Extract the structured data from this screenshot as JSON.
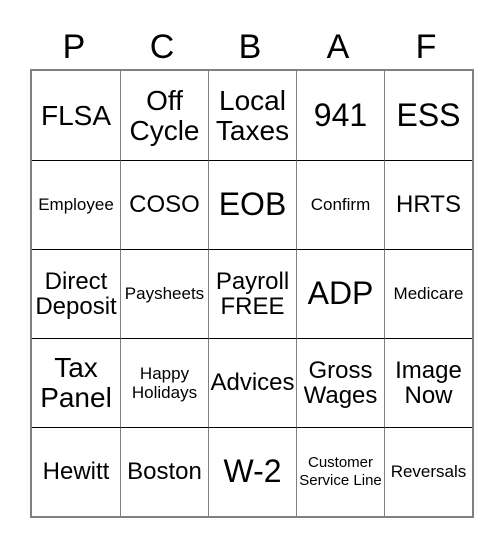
{
  "card": {
    "columns": [
      "P",
      "C",
      "B",
      "A",
      "F"
    ],
    "rows": [
      [
        {
          "text": "FLSA",
          "size": "lg"
        },
        {
          "text": "Off Cycle",
          "size": "lg"
        },
        {
          "text": "Local Taxes",
          "size": "lg"
        },
        {
          "text": "941",
          "size": "xl"
        },
        {
          "text": "ESS",
          "size": "xl"
        }
      ],
      [
        {
          "text": "Employee",
          "size": "sm"
        },
        {
          "text": "COSO",
          "size": "md"
        },
        {
          "text": "EOB",
          "size": "xl"
        },
        {
          "text": "Confirm",
          "size": "sm"
        },
        {
          "text": "HRTS",
          "size": "md"
        }
      ],
      [
        {
          "text": "Direct Deposit",
          "size": "md"
        },
        {
          "text": "Paysheets",
          "size": "sm"
        },
        {
          "text": "Payroll FREE",
          "size": "md"
        },
        {
          "text": "ADP",
          "size": "xl"
        },
        {
          "text": "Medicare",
          "size": "sm"
        }
      ],
      [
        {
          "text": "Tax Panel",
          "size": "lg"
        },
        {
          "text": "Happy Holidays",
          "size": "sm"
        },
        {
          "text": "Advices",
          "size": "md"
        },
        {
          "text": "Gross Wages",
          "size": "md"
        },
        {
          "text": "Image Now",
          "size": "md"
        }
      ],
      [
        {
          "text": "Hewitt",
          "size": "md"
        },
        {
          "text": "Boston",
          "size": "md"
        },
        {
          "text": "W-2",
          "size": "xl"
        },
        {
          "text": "Customer Service Line",
          "size": "xs"
        },
        {
          "text": "Reversals",
          "size": "sm"
        }
      ]
    ]
  },
  "colors": {
    "background": "#ffffff",
    "text": "#000000",
    "grid_line": "#808080",
    "row_line": "#000000"
  }
}
